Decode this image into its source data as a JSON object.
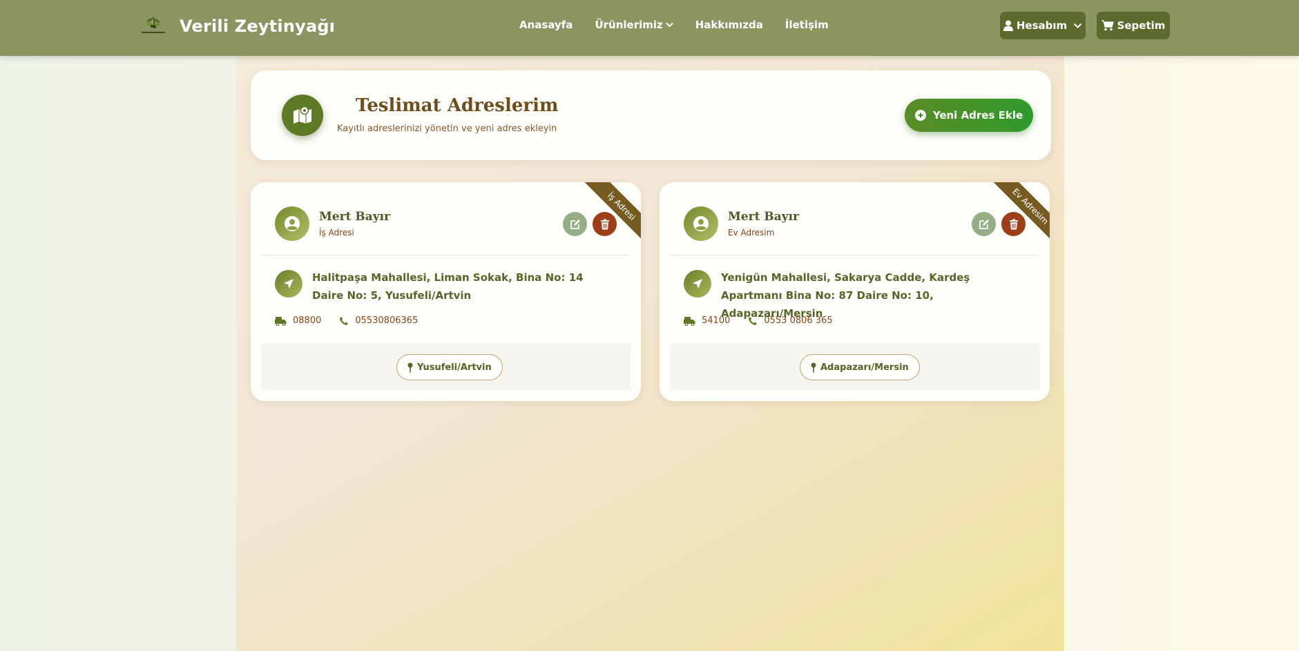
{
  "navbar": {
    "brand_name": "Verili Zeytinyağı",
    "links": [
      "Anasayfa",
      "Ürünlerimiz",
      "Hakkımızda",
      "İletişim"
    ],
    "account_label": "Hesabım",
    "cart_label": "Sepetim"
  },
  "page_header": {
    "title": "Teslimat Adreslerim",
    "subtitle": "Kayıtlı adreslerinizi yönetin ve yeni adres ekleyin",
    "add_button": "Yeni Adres Ekle"
  },
  "addresses": [
    {
      "ribbon": "İş Adresi",
      "name": "Mert Bayır",
      "type": "İş Adresi",
      "address": "Halitpaşa Mahallesi, Liman Sokak, Bina No: 14 Daire No: 5, Yusufeli/Artvin",
      "postal_code": "08800",
      "phone": "05530806365",
      "location": "Yusufeli/Artvin"
    },
    {
      "ribbon": "Ev Adresim",
      "name": "Mert Bayır",
      "type": "Ev Adresim",
      "address": "Yenigün Mahallesi, Sakarya Cadde, Kardeş Apartmanı Bina No: 87 Daire No: 10, Adapazarı/Mersin",
      "postal_code": "54100",
      "phone": "0553 0806 365",
      "location": "Adapazarı/Mersin"
    }
  ],
  "colors": {
    "navbar": "#8c9562",
    "button_dark": "#5c6a2e",
    "add_button": "#2f9a2c",
    "ribbon": "#755a22",
    "delete": "#9c3e17",
    "edit": "#95ae85"
  },
  "icons": [
    "olive-logo-icon",
    "chevron-down-icon",
    "user-icon",
    "cart-icon",
    "map-icon",
    "plus-circle-icon",
    "user-circle-icon",
    "edit-icon",
    "trash-icon",
    "location-arrow-icon",
    "shipping-icon",
    "phone-icon",
    "map-pin-icon"
  ]
}
